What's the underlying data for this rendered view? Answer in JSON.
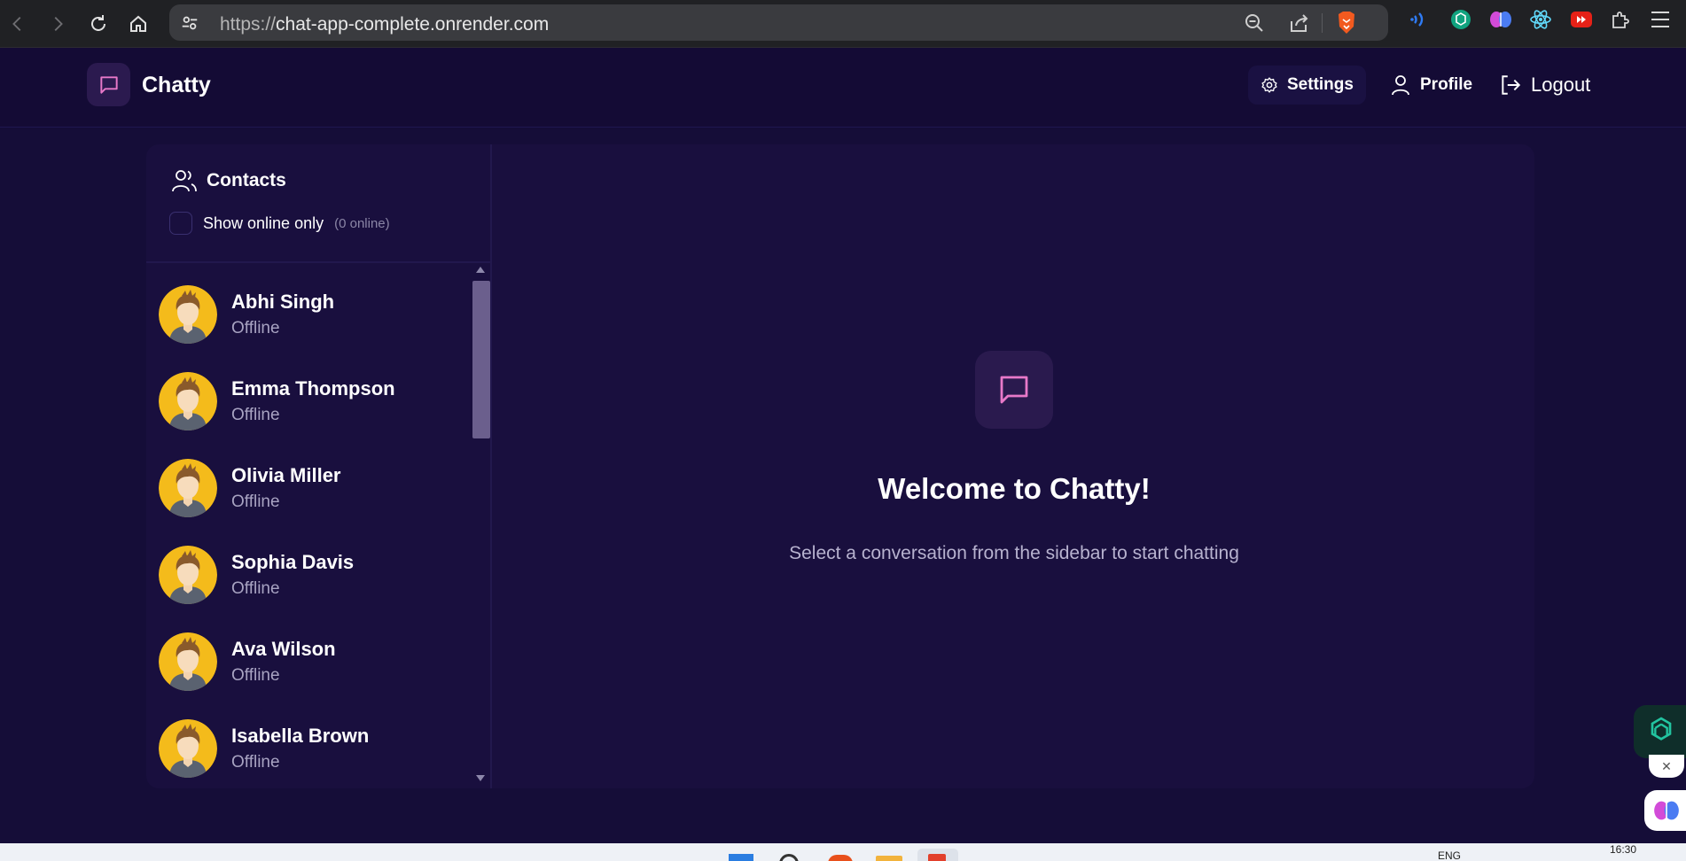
{
  "browser": {
    "url_scheme": "https://",
    "url_host": "chat-app-complete.onrender.com"
  },
  "header": {
    "brand": "Chatty",
    "settings_label": "Settings",
    "profile_label": "Profile",
    "logout_label": "Logout"
  },
  "sidebar": {
    "title": "Contacts",
    "online_filter_label": "Show online only",
    "online_count": "(0 online)",
    "contacts": [
      {
        "name": "Abhi Singh",
        "status": "Offline"
      },
      {
        "name": "Emma Thompson",
        "status": "Offline"
      },
      {
        "name": "Olivia Miller",
        "status": "Offline"
      },
      {
        "name": "Sophia Davis",
        "status": "Offline"
      },
      {
        "name": "Ava Wilson",
        "status": "Offline"
      },
      {
        "name": "Isabella Brown",
        "status": "Offline"
      }
    ]
  },
  "welcome": {
    "title": "Welcome to Chatty!",
    "subtitle": "Select a conversation from the sidebar to start chatting"
  },
  "taskbar": {
    "language": "ENG",
    "time": "16:30"
  },
  "colors": {
    "background": "#150d38",
    "panel": "#190f3e",
    "accent_pink": "#e879c9"
  }
}
